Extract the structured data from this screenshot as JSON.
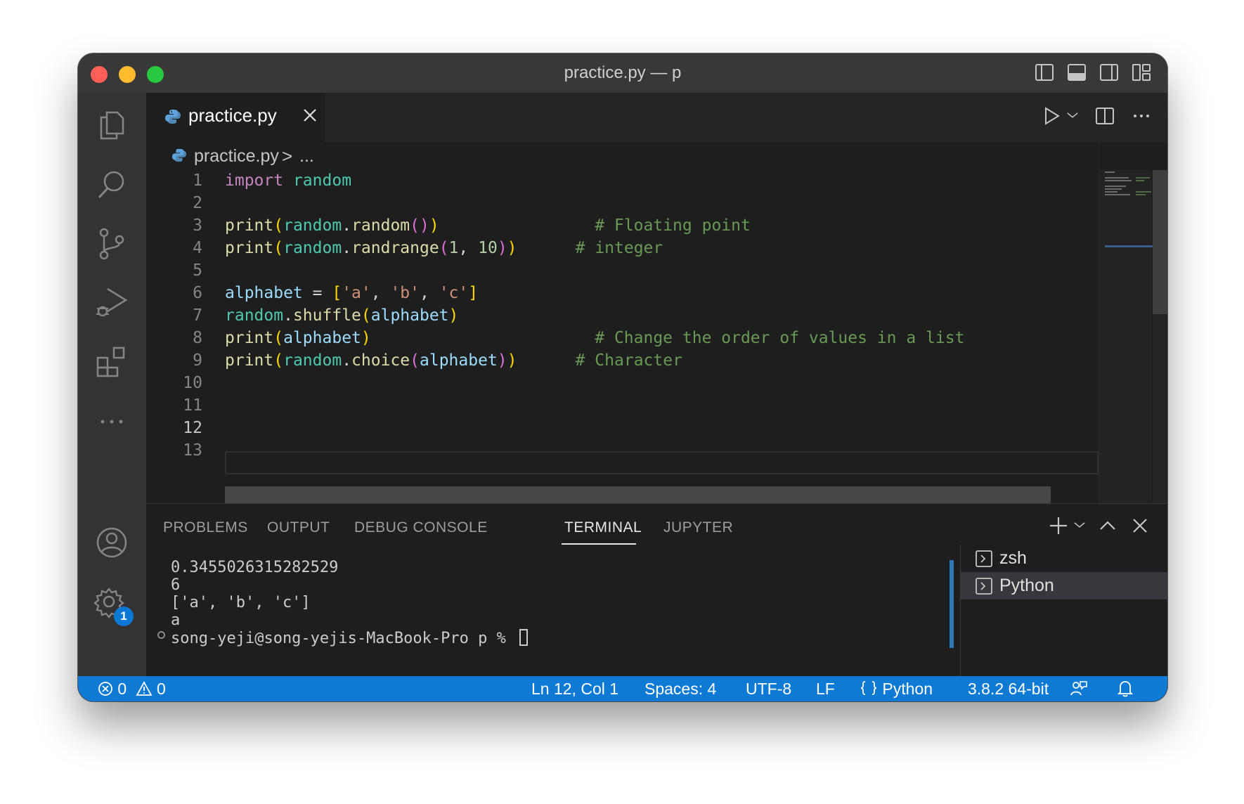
{
  "window": {
    "title": "practice.py — p"
  },
  "tab": {
    "label": "practice.py"
  },
  "breadcrumb": {
    "file": "practice.py",
    "separator": ">",
    "more": "..."
  },
  "editor": {
    "current_line": 12,
    "line_numbers": [
      "1",
      "2",
      "3",
      "4",
      "5",
      "6",
      "7",
      "8",
      "9",
      "10",
      "11",
      "12",
      "13"
    ]
  },
  "panel": {
    "tabs": [
      "PROBLEMS",
      "OUTPUT",
      "DEBUG CONSOLE",
      "TERMINAL",
      "JUPYTER"
    ],
    "active_tab": "TERMINAL",
    "terminal_lines": [
      "0.3455026315282529",
      "6",
      "['a', 'b', 'c']",
      "a"
    ],
    "prompt": "song-yeji@song-yejis-MacBook-Pro p % ",
    "terminals": [
      "zsh",
      "Python"
    ],
    "active_terminal": "Python"
  },
  "statusbar": {
    "errors": "0",
    "warnings": "0",
    "position": "Ln 12, Col 1",
    "spaces": "Spaces: 4",
    "encoding": "UTF-8",
    "eol": "LF",
    "language": "Python",
    "interpreter": "3.8.2 64-bit"
  },
  "activity": {
    "settings_badge": "1"
  },
  "icons": {
    "activity": [
      "explorer-icon",
      "search-icon",
      "source-control-icon",
      "run-debug-icon",
      "extensions-icon",
      "more-icon",
      "account-icon",
      "settings-gear-icon"
    ],
    "editor_actions": [
      "run-icon",
      "chevron-down-icon",
      "split-editor-icon",
      "more-actions-icon"
    ]
  },
  "colors": {
    "statusbar": "#0e7ad4",
    "keyword": "#c586c0",
    "module": "#4ec9b0",
    "function": "#dcdcaa",
    "variable": "#9cdcfe",
    "string": "#ce9178",
    "comment": "#6a9955",
    "number": "#b5cea8"
  }
}
